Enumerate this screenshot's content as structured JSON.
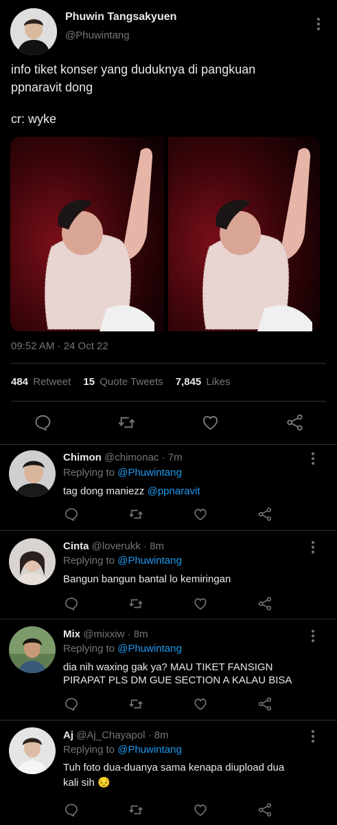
{
  "tweet": {
    "author_name": "Phuwin Tangsakyuen",
    "author_handle": "@Phuwintang",
    "text_line1": "info tiket konser yang duduknya di pangkuan",
    "text_line2": "ppnaravit dong",
    "text_line3": "cr: wyke",
    "timestamp": "09:52 AM · 24 Oct 22",
    "retweet_count": "484",
    "retweet_label": "Retweet",
    "quote_count": "15",
    "quote_label": "Quote Tweets",
    "likes_count": "7,845",
    "likes_label": "Likes"
  },
  "actions": [
    "reply-icon",
    "retweet-icon",
    "like-icon",
    "share-icon"
  ],
  "replies": [
    {
      "name": "Chimon",
      "handle": "@chimonac",
      "time": "· 7m",
      "replying_prefix": "Replying to",
      "replying_to": "@Phuwintang",
      "text_line1": "tag dong maniezz",
      "mention": "@ppnaravit",
      "text_line2": ""
    },
    {
      "name": "Cinta",
      "handle": "@loverukk",
      "time": "· 8m",
      "replying_prefix": "Replying to",
      "replying_to": "@Phuwintang",
      "text_line1": "Bangun bangun bantal lo kemiringan",
      "mention": "",
      "text_line2": ""
    },
    {
      "name": "Mix",
      "handle": "@mixxiw",
      "time": "· 8m",
      "replying_prefix": "Replying to",
      "replying_to": "@Phuwintang",
      "text_line1": "dia nih waxing gak ya? MAU TIKET FANSIGN",
      "mention": "",
      "text_line2": "PIRAPAT PLS DM GUE SECTION A KALAU BISA"
    },
    {
      "name": "Aj",
      "handle": "@Aj_Chayapol",
      "time": "· 8m",
      "replying_prefix": "Replying to",
      "replying_to": "@Phuwintang",
      "text_line1": "Tuh foto dua-duanya sama kenapa diupload dua",
      "mention": "",
      "text_line2": "kali sih 😔"
    }
  ],
  "colors": {
    "background": "#000000",
    "accent": "#1d9bf0",
    "muted": "#71767b",
    "divider": "#2f3336"
  }
}
